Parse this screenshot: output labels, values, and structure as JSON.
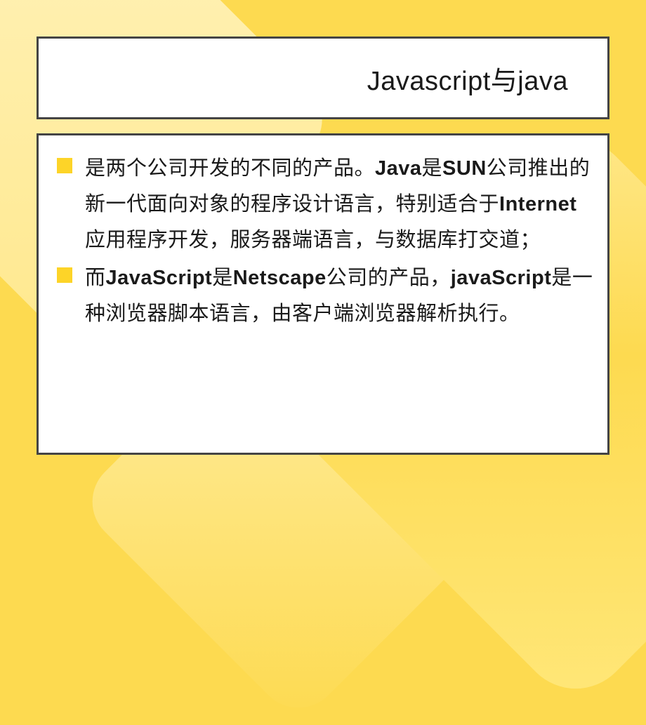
{
  "slide": {
    "title": "Javascript与java",
    "bullets": [
      {
        "segments": [
          {
            "text": "是两个公司开发的不同的产品。",
            "bold": false
          },
          {
            "text": "Java",
            "bold": true
          },
          {
            "text": "是",
            "bold": false
          },
          {
            "text": "SUN",
            "bold": true
          },
          {
            "text": "公司推出的新一代面向对象的程序设计语言，特别适合于",
            "bold": false
          },
          {
            "text": "Internet",
            "bold": true
          },
          {
            "text": "应用程序开发，服务器端语言，与数据库打交道；",
            "bold": false
          }
        ]
      },
      {
        "segments": [
          {
            "text": "而",
            "bold": false
          },
          {
            "text": "JavaScript",
            "bold": true
          },
          {
            "text": "是",
            "bold": false
          },
          {
            "text": "Netscape",
            "bold": true
          },
          {
            "text": "公司的产品，",
            "bold": false
          },
          {
            "text": "javaScript",
            "bold": true
          },
          {
            "text": "是一种浏览器脚本语言，由客户端浏览器解析执行。",
            "bold": false
          }
        ]
      }
    ]
  }
}
